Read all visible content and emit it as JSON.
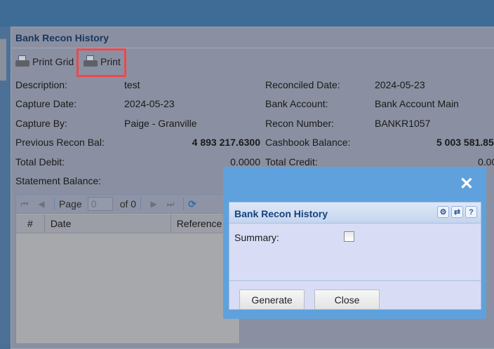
{
  "window": {
    "title": "Bank Recon History"
  },
  "toolbar": {
    "print_grid": "Print Grid",
    "print": "Print"
  },
  "fields_left": [
    {
      "label": "Description:",
      "value": "test"
    },
    {
      "label": "Capture Date:",
      "value": "2024-05-23"
    },
    {
      "label": "Capture By:",
      "value": "Paige - Granville"
    },
    {
      "label": "Previous Recon Bal:",
      "value": "4 893 217.6300"
    },
    {
      "label": "Total Debit:",
      "value": "0.0000"
    },
    {
      "label": "Statement Balance:",
      "value": ""
    }
  ],
  "fields_right": [
    {
      "label": "Reconciled Date:",
      "value": "2024-05-23"
    },
    {
      "label": "Bank Account:",
      "value": "Bank Account Main"
    },
    {
      "label": "Recon Number:",
      "value": "BANKR1057"
    },
    {
      "label": "Cashbook Balance:",
      "value": "5 003 581.85"
    },
    {
      "label": "Total Credit:",
      "value": "0.00"
    }
  ],
  "grid": {
    "page_label": "Page",
    "page_value": "0",
    "of_label": "of 0",
    "columns": [
      "#",
      "Date",
      "Reference"
    ]
  },
  "dialog": {
    "title": "Bank Recon History",
    "summary_label": "Summary:",
    "summary_checked": false,
    "generate": "Generate",
    "close": "Close"
  }
}
